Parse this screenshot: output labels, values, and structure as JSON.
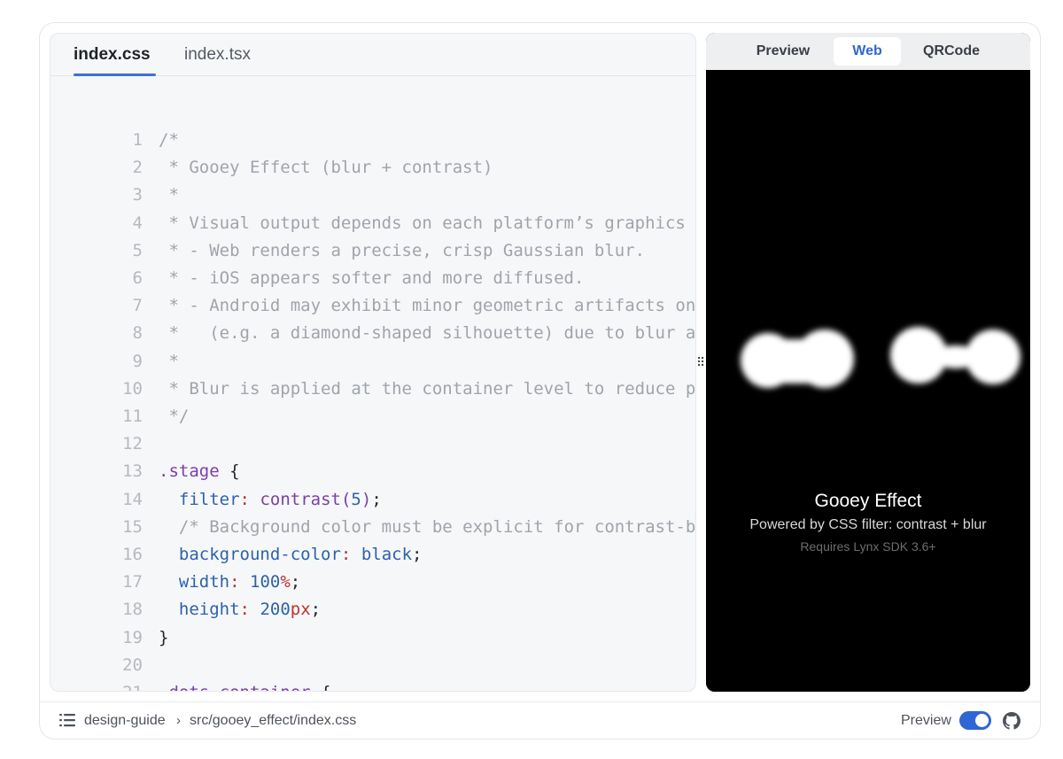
{
  "editor": {
    "tabs": [
      {
        "label": "index.css",
        "active": true
      },
      {
        "label": "index.tsx",
        "active": false
      }
    ],
    "lines": [
      [
        [
          "c",
          "/*"
        ]
      ],
      [
        [
          "c",
          " * Gooey Effect (blur + contrast)"
        ]
      ],
      [
        [
          "c",
          " *"
        ]
      ],
      [
        [
          "c",
          " * Visual output depends on each platform’s graphics pipeline"
        ]
      ],
      [
        [
          "c",
          " * - Web renders a precise, crisp Gaussian blur."
        ]
      ],
      [
        [
          "c",
          " * - iOS appears softer and more diffused."
        ]
      ],
      [
        [
          "c",
          " * - Android may exhibit minor geometric artifacts on small"
        ]
      ],
      [
        [
          "c",
          " *   (e.g. a diamond-shaped silhouette) due to blur and down"
        ]
      ],
      [
        [
          "c",
          " *"
        ]
      ],
      [
        [
          "c",
          " * Blur is applied at the container level to reduce per-elem"
        ]
      ],
      [
        [
          "c",
          " */"
        ]
      ],
      [],
      [
        [
          "s",
          ".stage"
        ],
        [
          "p",
          " {"
        ]
      ],
      [
        [
          "p",
          "  "
        ],
        [
          "k",
          "filter"
        ],
        [
          "u",
          ":"
        ],
        [
          "p",
          " "
        ],
        [
          "f",
          "contrast"
        ],
        [
          "f",
          "("
        ],
        [
          "n",
          "5"
        ],
        [
          "f",
          ")"
        ],
        [
          "p",
          ";"
        ]
      ],
      [
        [
          "p",
          "  "
        ],
        [
          "c",
          "/* Background color must be explicit for contrast-based th"
        ]
      ],
      [
        [
          "p",
          "  "
        ],
        [
          "k",
          "background-color"
        ],
        [
          "u",
          ":"
        ],
        [
          "p",
          " "
        ],
        [
          "v",
          "black"
        ],
        [
          "p",
          ";"
        ]
      ],
      [
        [
          "p",
          "  "
        ],
        [
          "k",
          "width"
        ],
        [
          "u",
          ":"
        ],
        [
          "p",
          " "
        ],
        [
          "n",
          "100"
        ],
        [
          "u",
          "%"
        ],
        [
          "p",
          ";"
        ]
      ],
      [
        [
          "p",
          "  "
        ],
        [
          "k",
          "height"
        ],
        [
          "u",
          ":"
        ],
        [
          "p",
          " "
        ],
        [
          "n",
          "200"
        ],
        [
          "u",
          "px"
        ],
        [
          "p",
          ";"
        ]
      ],
      [
        [
          "p",
          "}"
        ]
      ],
      [],
      [
        [
          "s",
          ".dots-container"
        ],
        [
          "p",
          " {"
        ]
      ]
    ]
  },
  "preview": {
    "tabs": [
      {
        "label": "Preview",
        "active": false
      },
      {
        "label": "Web",
        "active": true
      },
      {
        "label": "QRCode",
        "active": false
      }
    ],
    "title": "Gooey Effect",
    "subtitle": "Powered by CSS filter: contrast + blur",
    "requirement": "Requires Lynx SDK 3.6+"
  },
  "footer": {
    "project": "design-guide",
    "path": "src/gooey_effect/index.css",
    "toggle_label": "Preview",
    "toggle_on": true,
    "icons": [
      "list-icon",
      "chevron-right-icon",
      "github-icon"
    ]
  }
}
